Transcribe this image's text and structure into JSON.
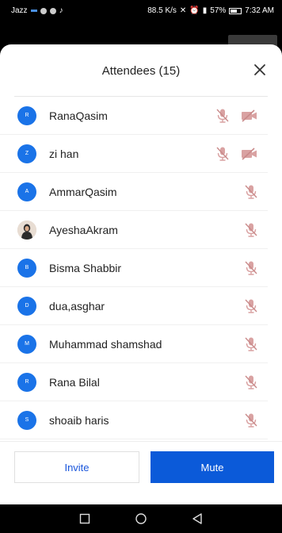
{
  "status_bar": {
    "carrier": "Jazz",
    "speed": "88.5 K/s",
    "battery": "57%",
    "time": "7:32 AM"
  },
  "sheet": {
    "title": "Attendees (15)"
  },
  "attendees": [
    {
      "initial": "R",
      "name": "RanaQasim",
      "video_off": true
    },
    {
      "initial": "Z",
      "name": "zi han",
      "video_off": true
    },
    {
      "initial": "A",
      "name": "AmmarQasim",
      "video_off": false
    },
    {
      "initial": "",
      "name": "AyeshaAkram",
      "video_off": false,
      "photo": true
    },
    {
      "initial": "B",
      "name": "Bisma Shabbir",
      "video_off": false
    },
    {
      "initial": "D",
      "name": "dua,asghar",
      "video_off": false
    },
    {
      "initial": "M",
      "name": "Muhammad shamshad",
      "video_off": false
    },
    {
      "initial": "R",
      "name": "Rana Bilal",
      "video_off": false
    },
    {
      "initial": "S",
      "name": "shoaib haris",
      "video_off": false
    }
  ],
  "footer": {
    "invite_label": "Invite",
    "mute_label": "Mute"
  },
  "colors": {
    "accent": "#1a73e8",
    "mute_button": "#0b5ad9",
    "muted_icon": "#c98a8a"
  }
}
